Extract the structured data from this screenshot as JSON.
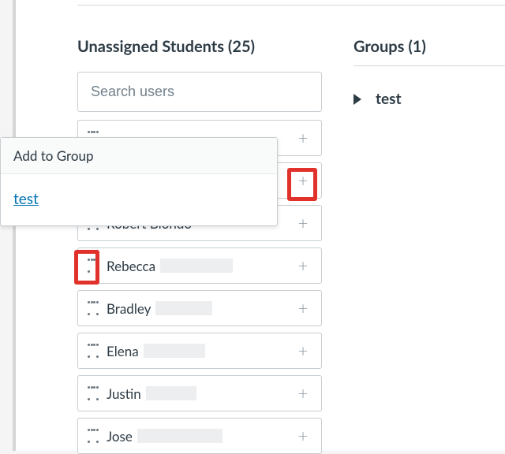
{
  "unassigned": {
    "title": "Unassigned Students (25)",
    "search_placeholder": "Search users",
    "students": [
      {
        "name": "",
        "redact_width": 0
      },
      {
        "name": "",
        "redact_width": 0
      },
      {
        "name": "Robert Biondo",
        "redact_width": 0
      },
      {
        "name": "Rebecca",
        "redact_width": 92
      },
      {
        "name": "Bradley",
        "redact_width": 72
      },
      {
        "name": "Elena",
        "redact_width": 78
      },
      {
        "name": "Justin",
        "redact_width": 64
      },
      {
        "name": "Jose",
        "redact_width": 108
      }
    ]
  },
  "groups": {
    "title": "Groups (1)",
    "items": [
      {
        "name": "test"
      }
    ]
  },
  "popover": {
    "title": "Add to Group",
    "link": "test"
  }
}
